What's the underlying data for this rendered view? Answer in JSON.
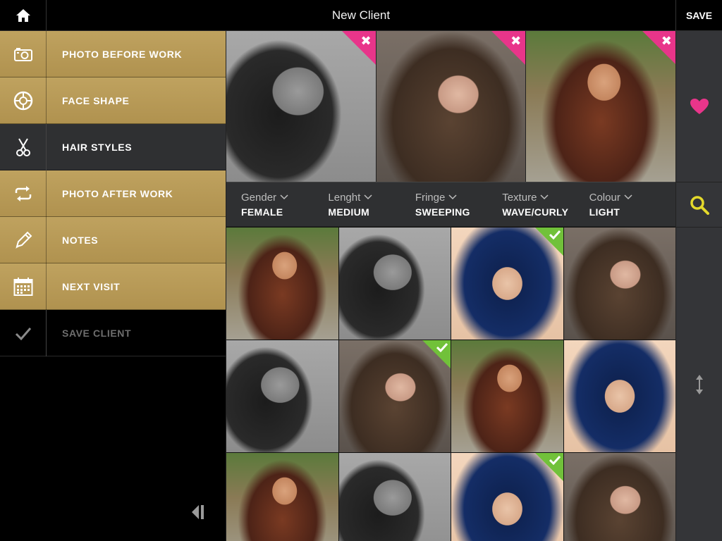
{
  "header": {
    "home_icon": "home-icon",
    "title": "New Client",
    "save_label": "SAVE"
  },
  "sidebar": {
    "items": [
      {
        "label": "PHOTO BEFORE WORK",
        "icon": "camera-icon",
        "state": "gold"
      },
      {
        "label": "FACE SHAPE",
        "icon": "face-target-icon",
        "state": "gold"
      },
      {
        "label": "HAIR STYLES",
        "icon": "scissors-icon",
        "state": "active"
      },
      {
        "label": "PHOTO AFTER WORK",
        "icon": "repeat-icon",
        "state": "gold"
      },
      {
        "label": "NOTES",
        "icon": "pencil-icon",
        "state": "gold"
      },
      {
        "label": "NEXT VISIT",
        "icon": "calendar-icon",
        "state": "gold"
      },
      {
        "label": "SAVE CLIENT",
        "icon": "checkmark-icon",
        "state": "disabled"
      }
    ],
    "collapse_icon": "collapse-sidebar-icon"
  },
  "selected_styles": [
    {
      "style": "bw",
      "badge": "remove"
    },
    {
      "style": "brunette",
      "badge": "remove"
    },
    {
      "style": "shades",
      "badge": "remove"
    }
  ],
  "filters": [
    {
      "name": "Gender",
      "value": "FEMALE"
    },
    {
      "name": "Lenght",
      "value": "MEDIUM"
    },
    {
      "name": "Fringe",
      "value": "SWEEPING"
    },
    {
      "name": "Texture",
      "value": "WAVE/CURLY"
    },
    {
      "name": "Colour",
      "value": "LIGHT"
    }
  ],
  "results": [
    {
      "style": "shades",
      "checked": false
    },
    {
      "style": "bw",
      "checked": false
    },
    {
      "style": "blue",
      "checked": true
    },
    {
      "style": "brunette",
      "checked": false
    },
    {
      "style": "bw",
      "checked": false
    },
    {
      "style": "brunette",
      "checked": true
    },
    {
      "style": "shades",
      "checked": false
    },
    {
      "style": "blue",
      "checked": false
    },
    {
      "style": "shades",
      "checked": false
    },
    {
      "style": "bw",
      "checked": false
    },
    {
      "style": "blue",
      "checked": true
    },
    {
      "style": "brunette",
      "checked": false
    }
  ],
  "rail": {
    "favorite_icon": "heart-icon",
    "search_icon": "search-icon",
    "resize_icon": "vertical-resize-icon"
  },
  "colors": {
    "gold": "#bfa25f",
    "pink": "#e8358a",
    "green": "#71c13a",
    "search_yellow": "#e4d92b"
  }
}
